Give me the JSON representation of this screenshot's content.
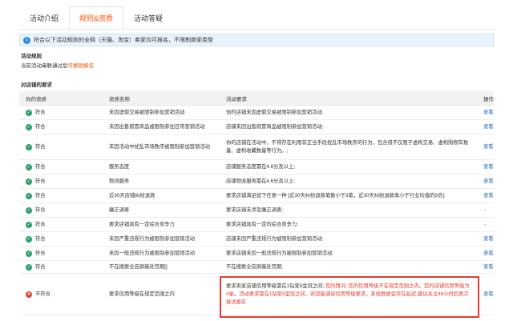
{
  "tabs": [
    "活动介绍",
    "规则&资质",
    "活动答疑"
  ],
  "notice": "符合以下活动规则的全网（天猫、淘宝）卖家均可报名，不限制商家类型",
  "activity_rules": {
    "title": "活动规则",
    "text": "当前活动串联通过后",
    "link": "可撤销报名"
  },
  "store_requirements_title": "对店铺的要求",
  "table": {
    "headers": [
      "你的资质",
      "资质名称",
      "活动要求",
      "操作"
    ],
    "rows": [
      {
        "status": "符合",
        "ok": true,
        "name": "未因虚假交易被限制参加营销活动",
        "req": "你的店铺未因虚假交易被限制参加营销活动;",
        "op": "查看"
      },
      {
        "status": "符合",
        "ok": true,
        "name": "未因出售假冒商品被限制参加日常营销活动",
        "req": "店铺未因出售假冒商品被限制参加营销活动;",
        "op": "查看"
      },
      {
        "status": "符合",
        "ok": true,
        "name": "未因活动中扰乱市场秩序被限制参加营销活动",
        "req": "你的店铺在活动中，不得存在利用非正当手段扰乱市场秩序的行为，包含但不仅限于虚构交易、虚构购物车数量、虚构收藏数量等行为。;",
        "op": "查看"
      },
      {
        "status": "符合",
        "ok": true,
        "name": "服务态度",
        "req": "店铺服务态度需在4.6分及以上;",
        "op": "查看"
      },
      {
        "status": "符合",
        "ok": true,
        "name": "物流服务",
        "req": "店铺物流服务需在4.6分及以上;",
        "op": "查看"
      },
      {
        "status": "符合",
        "ok": true,
        "name": "近30天店铺纠纷退款",
        "req": "要求店铺满足如下任意一种 [近30天纠纷退款笔数小于3笔，近30天纠纷退款率小于行业均值的5倍];",
        "op": "查看"
      },
      {
        "status": "符合",
        "ok": true,
        "name": "廉正调查",
        "req": "要求店铺未涉及廉正调查;",
        "op": "--"
      },
      {
        "status": "符合",
        "ok": true,
        "name": "要求店铺具有一定综合竞争力",
        "req": "要求店铺具有一定的综合竞争力;",
        "op": "--"
      },
      {
        "status": "符合",
        "ok": true,
        "name": "未因严重违规行为被限制参加营销活动",
        "req": "店铺未因严重违规行为被限制参加营销活动;",
        "op": "查看"
      },
      {
        "status": "符合",
        "ok": true,
        "name": "未因一般违规行为被限制参加营销活动",
        "req": "要求店铺未因一般违规行为被限制参加营销活动;",
        "op": "查看"
      },
      {
        "status": "符合",
        "ok": true,
        "name": "不在搜索全店屏蔽处罚期[]",
        "req": "不在搜索全店屏蔽处罚期;",
        "op": "查看"
      },
      {
        "status": "不符合",
        "ok": false,
        "name": "要求信用等级在规定范围之内",
        "req_black": "要求卖家店铺信用等级需在1钻至5金冠之间;",
        "req_red": " 您的情况: 您的信用等级不在规定范围之内。您的店铺信用等级为4星。活动要求需在1钻至5金冠之间，若您能满足信用等级要求，系统数据会存在延迟,建议关注48小时后再次尝试报名",
        "op": "查看"
      }
    ]
  },
  "colors": {
    "accent": "#ff5000",
    "ok": "#2e9e6e",
    "bad": "#e0453b",
    "link": "#2f6fc9",
    "highlight": "#e63b30"
  }
}
